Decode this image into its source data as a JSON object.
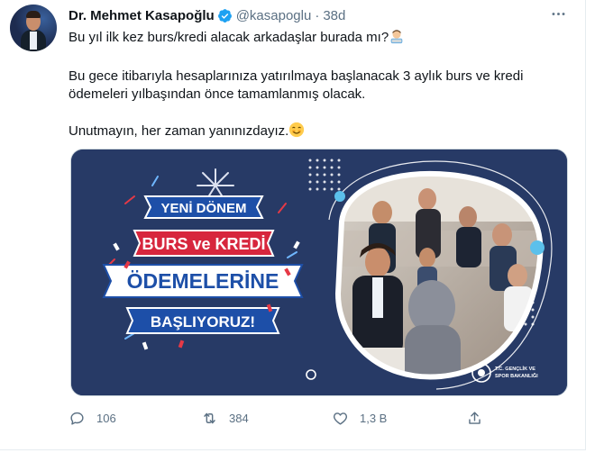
{
  "tweet": {
    "author_name": "Dr. Mehmet Kasapoğlu",
    "handle": "@kasapoglu",
    "separator": "·",
    "time": "38d",
    "text_line1": "Bu yıl ilk kez burs/kredi alacak arkadaşlar burada mı?",
    "text_p2": "Bu gece itibarıyla hesaplarınıza yatırılmaya başlanacak 3 aylık burs ve kredi ödemeleri yılbaşından önce tamamlanmış olacak.",
    "text_p3": "Unutmayın, her zaman yanınızdayız.",
    "more_label": "···"
  },
  "media": {
    "line1": "YENİ DÖNEM",
    "line2": "BURS ve KREDİ",
    "line3": "ÖDEMELERİNE",
    "line4": "BAŞLIYORUZ!",
    "logo_text_1": "T.C. GENÇLİK VE",
    "logo_text_2": "SPOR BAKANLIĞI"
  },
  "actions": {
    "reply_count": "106",
    "retweet_count": "384",
    "like_count": "1,3 B"
  },
  "icons": {
    "verified": "verified-badge-icon",
    "reply": "reply-icon",
    "retweet": "retweet-icon",
    "like": "heart-icon",
    "share": "share-icon",
    "more": "more-icon"
  },
  "colors": {
    "muted": "#5b7083",
    "verified": "#1da1f2",
    "banner_bg": "#273a66",
    "ribbon_blue": "#1d4fa8",
    "ribbon_red": "#d7263d"
  }
}
